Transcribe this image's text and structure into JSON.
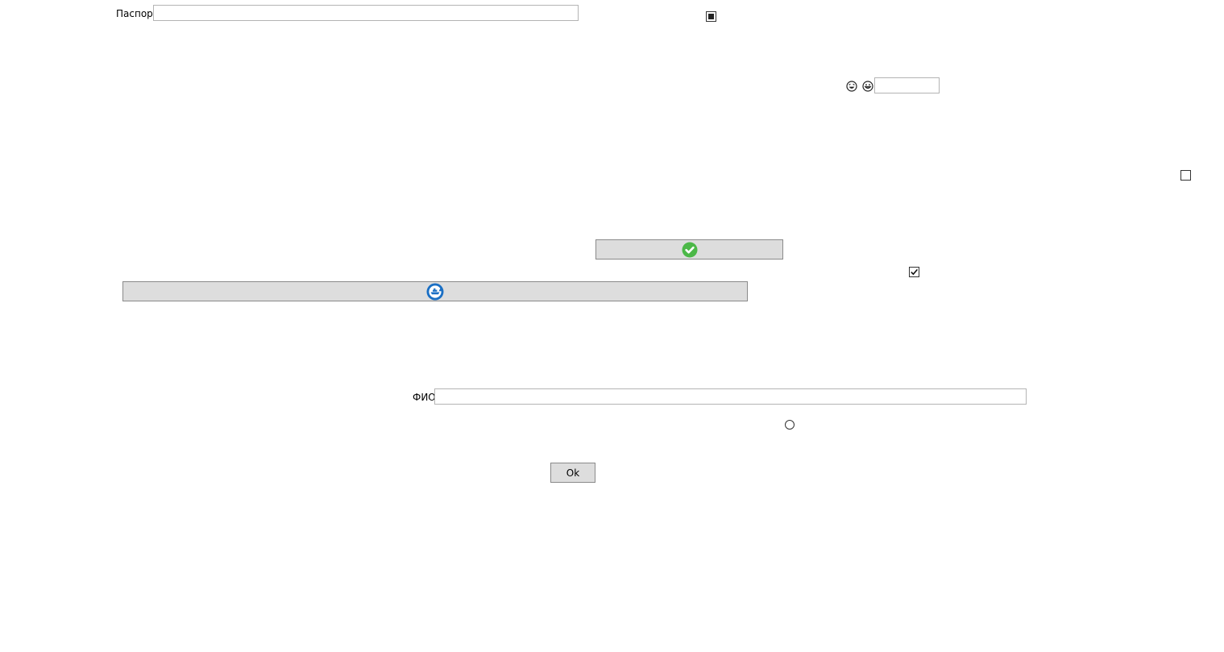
{
  "passport": {
    "label": "Паспорт",
    "value": ""
  },
  "checkbox_indeterminate": {
    "state": "indeterminate"
  },
  "emoji_field": {
    "icons": [
      "laughing-face-icon",
      "grinning-face-icon"
    ],
    "value": ""
  },
  "checkbox_unchecked": {
    "state": "unchecked"
  },
  "confirm_button": {
    "icon": "green-check-icon",
    "label": ""
  },
  "checkbox_checked": {
    "state": "checked"
  },
  "refresh_button": {
    "icon": "blue-ship-refresh-icon",
    "label": ""
  },
  "fio": {
    "label": "ФИО",
    "value": ""
  },
  "radio_option": {
    "state": "unselected"
  },
  "ok_button": {
    "label": "Ok"
  },
  "colors": {
    "button_face": "#dddddd",
    "field_border": "#b4b4b4",
    "check_green": "#4cb848",
    "refresh_blue": "#1a6fc4"
  }
}
